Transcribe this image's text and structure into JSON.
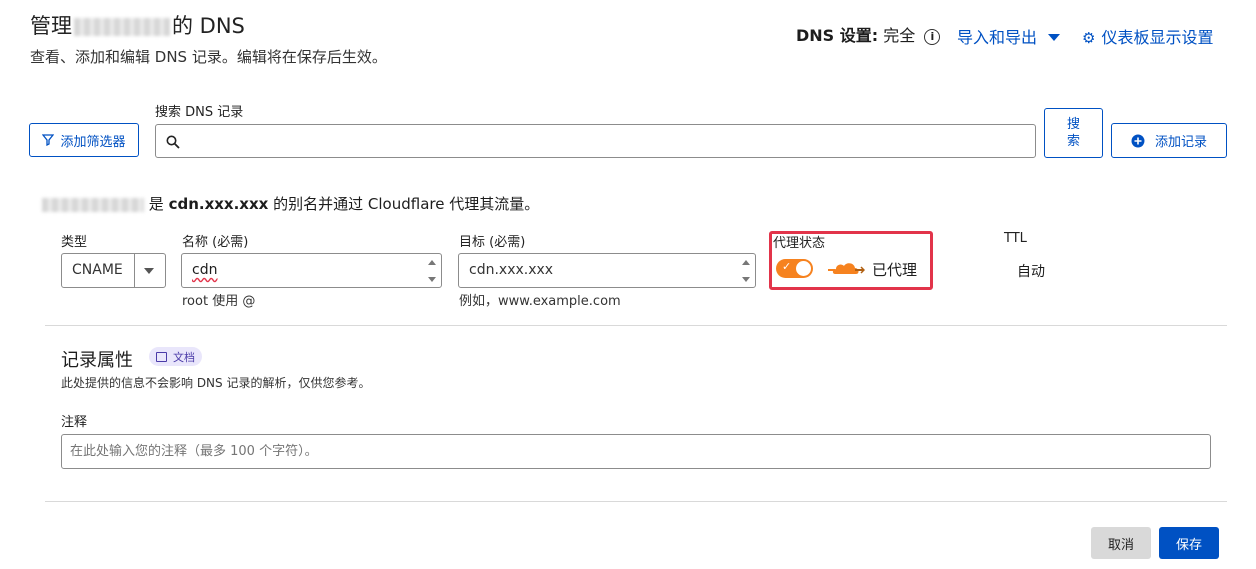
{
  "header": {
    "title_prefix": "管理",
    "title_suffix": "的 DNS",
    "subtitle": "查看、添加和编辑 DNS 记录。编辑将在保存后生效。",
    "dns_setting_label": "DNS 设置:",
    "dns_setting_value": "完全",
    "import_export": "导入和导出",
    "dashboard_settings": "仪表板显示设置"
  },
  "toolbar": {
    "add_filter": "添加筛选器",
    "search_label": "搜索 DNS 记录",
    "search_button": "搜索",
    "add_record": "添加记录"
  },
  "alias_note": {
    "pre": "是",
    "target": "cdn.xxx.xxx",
    "post": "的别名并通过 Cloudflare 代理其流量。"
  },
  "record_form": {
    "type_label": "类型",
    "type_value": "CNAME",
    "name_label": "名称 (必需)",
    "name_value": "cdn",
    "name_hint": "root 使用 @",
    "target_label": "目标 (必需)",
    "target_value": "cdn.xxx.xxx",
    "target_hint": "例如，www.example.com",
    "proxy_label": "代理状态",
    "proxy_status": "已代理",
    "proxy_enabled": true,
    "ttl_label": "TTL",
    "ttl_value": "自动"
  },
  "attributes": {
    "title": "记录属性",
    "doc_badge": "文档",
    "description": "此处提供的信息不会影响 DNS 记录的解析，仅供您参考。",
    "comment_label": "注释",
    "comment_placeholder": "在此处输入您的注释（最多 100 个字符）。"
  },
  "actions": {
    "cancel": "取消",
    "save": "保存"
  },
  "colors": {
    "accent": "#0051c3",
    "proxy_orange": "#f6821f",
    "highlight_red": "#e2344a"
  }
}
